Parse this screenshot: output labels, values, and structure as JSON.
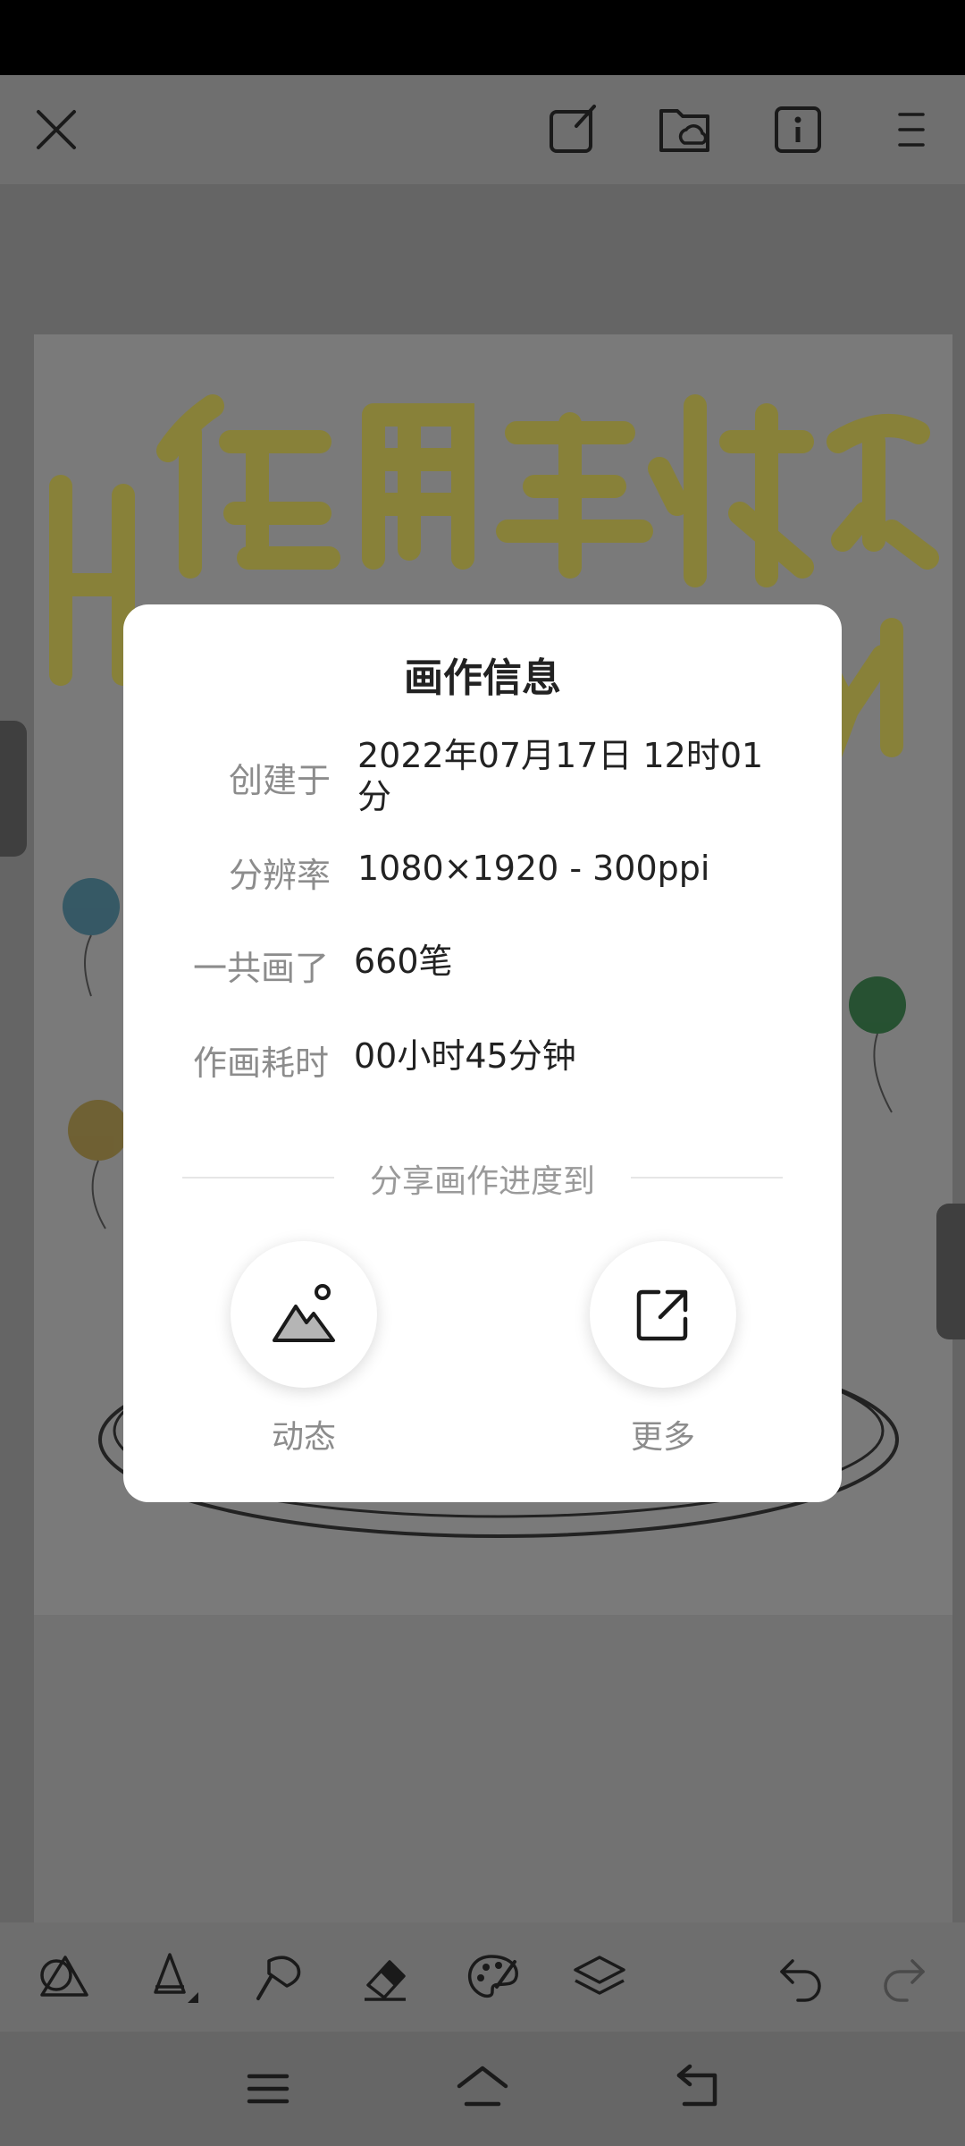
{
  "dialog": {
    "title": "画作信息",
    "rows": [
      {
        "label": "创建于",
        "value": "2022年07月17日 12时01分"
      },
      {
        "label": "分辨率",
        "value": "1080×1920 - 300ppi"
      },
      {
        "label": "一共画了",
        "value": "660笔"
      },
      {
        "label": "作画耗时",
        "value": "00小时45分钟"
      }
    ],
    "share_title": "分享画作进度到",
    "share_buttons": [
      {
        "label": "动态",
        "icon": "mountain-image-icon"
      },
      {
        "label": "更多",
        "icon": "external-share-icon"
      }
    ]
  },
  "top_bar_icons": [
    "close-icon",
    "export-icon",
    "cloud-folder-icon",
    "info-icon",
    "menu-icon"
  ],
  "toolbar_icons": [
    "shapes-icon",
    "brush-icon",
    "smudge-icon",
    "eraser-icon",
    "palette-icon",
    "layers-icon",
    "undo-icon",
    "redo-icon"
  ],
  "nav_icons": [
    "menu-lines-icon",
    "home-icon",
    "back-icon"
  ],
  "colors": {
    "overlay": "#6a6a6a",
    "dialog_bg": "#ffffff",
    "icon_dark": "#1a1a1a"
  }
}
